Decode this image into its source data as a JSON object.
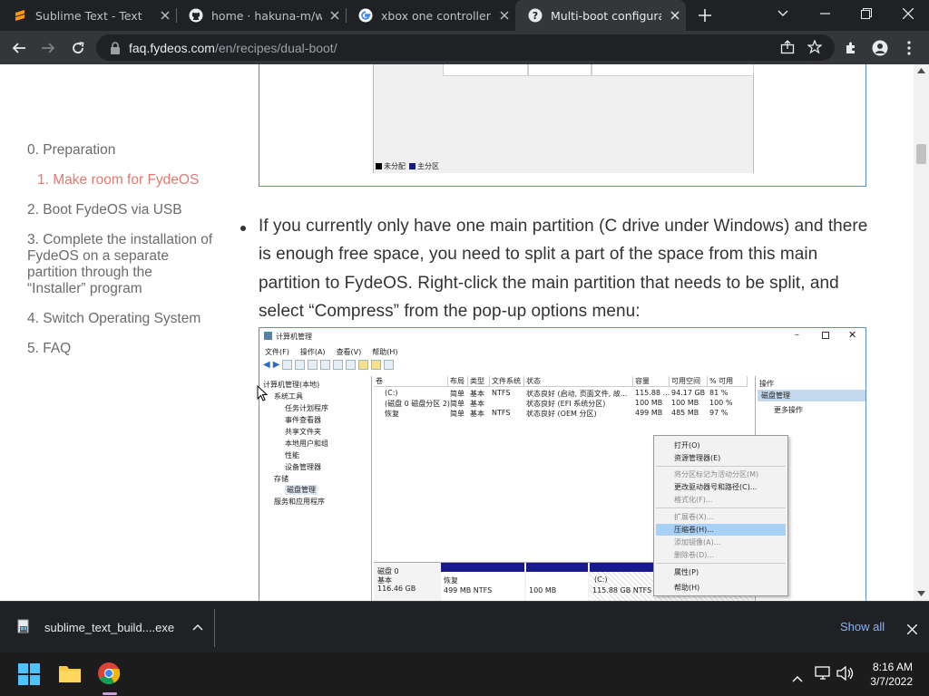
{
  "browser": {
    "tabs": [
      {
        "title": "Sublime Text - Text Editor",
        "icon": "sublime-icon"
      },
      {
        "title": "home · hakuna-m/wubi",
        "icon": "github-icon"
      },
      {
        "title": "xbox one controller chrome",
        "icon": "google-icon"
      },
      {
        "title": "Multi-boot configuration",
        "icon": "fydeos-icon",
        "active": true
      }
    ],
    "url_host": "faq.fydeos.com",
    "url_path": "/en/recipes/dual-boot/"
  },
  "toc": {
    "items": [
      {
        "label": "0. Preparation"
      },
      {
        "label": "1. Make room for FydeOS",
        "active": true
      },
      {
        "label": "2. Boot FydeOS via USB"
      },
      {
        "label": "3. Complete the installation of FydeOS on a separate partition through the “Installer” program"
      },
      {
        "label": "4. Switch Operating System"
      },
      {
        "label": "5. FAQ"
      }
    ]
  },
  "article": {
    "legend_unallocated": "未分配",
    "legend_primary": "主分区",
    "paragraph": "If you currently only have one main partition (C drive under Windows) and there is enough free space, you need to split a part of the space from this main partition to FydeOS. Right-click the main partition that needs to be split, and select “Compress” from the pop-up options menu:"
  },
  "diskmgmt": {
    "window_title": "计算机管理",
    "menus": [
      "文件(F)",
      "操作(A)",
      "查看(V)",
      "帮助(H)"
    ],
    "tree": [
      "计算机管理(本地)",
      "系统工具",
      "任务计划程序",
      "事件查看器",
      "共享文件夹",
      "本地用户和组",
      "性能",
      "设备管理器",
      "存储",
      "磁盘管理",
      "服务和应用程序"
    ],
    "columns": [
      "卷",
      "布局",
      "类型",
      "文件系统",
      "状态",
      "容量",
      "可用空间",
      "% 可用"
    ],
    "rows": [
      [
        "(C:)",
        "简单",
        "基本",
        "NTFS",
        "状态良好 (启动, 页面文件, 故...",
        "115.88 ...",
        "94.17 GB",
        "81 %"
      ],
      [
        "(磁盘 0 磁盘分区 2)",
        "简单",
        "基本",
        "",
        "状态良好 (EFI 系统分区)",
        "100 MB",
        "100 MB",
        "100 %"
      ],
      [
        "恢复",
        "简单",
        "基本",
        "NTFS",
        "状态良好 (OEM 分区)",
        "499 MB",
        "485 MB",
        "97 %"
      ]
    ],
    "actions_title": "操作",
    "actions_section": "磁盘管理",
    "actions_more": "更多操作",
    "disk_label": "磁盘 0",
    "disk_type": "基本",
    "disk_size": "116.46 GB",
    "partitions": [
      {
        "name": "恢复",
        "size": "499 MB NTFS"
      },
      {
        "name": "",
        "size": "100 MB"
      },
      {
        "name": "(C:)",
        "size": "115.88 GB NTFS"
      }
    ],
    "context_menu": [
      {
        "label": "打开(O)",
        "state": "normal"
      },
      {
        "label": "资源管理器(E)",
        "state": "normal"
      },
      {
        "label": "将分区标记为活动分区(M)",
        "state": "disabled"
      },
      {
        "label": "更改驱动器号和路径(C)...",
        "state": "normal"
      },
      {
        "label": "格式化(F)...",
        "state": "disabled"
      },
      {
        "label": "扩展卷(X)...",
        "state": "disabled"
      },
      {
        "label": "压缩卷(H)...",
        "state": "highlighted"
      },
      {
        "label": "添加镜像(A)...",
        "state": "disabled"
      },
      {
        "label": "删除卷(D)...",
        "state": "disabled"
      },
      {
        "label": "属性(P)",
        "state": "normal"
      },
      {
        "label": "帮助(H)",
        "state": "normal"
      }
    ]
  },
  "downloads": {
    "filename": "sublime_text_build....exe",
    "show_all": "Show all"
  },
  "taskbar": {
    "time": "8:16 AM",
    "date": "3/7/2022"
  }
}
